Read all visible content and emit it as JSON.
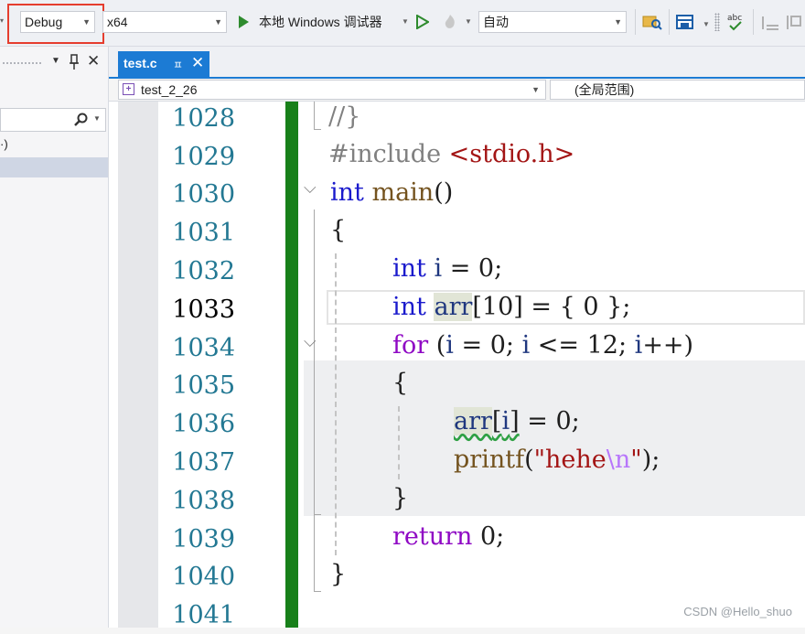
{
  "toolbar": {
    "config": "Debug",
    "platform": "x64",
    "run_target": "本地 Windows 调试器",
    "mode": "自动"
  },
  "left_panel": {
    "partial_item": "·)"
  },
  "tabs": [
    {
      "label": "test.c",
      "pin": "ㅍ",
      "close": "✕"
    }
  ],
  "navbar": {
    "project": "test_2_26",
    "scope": "(全局范围)"
  },
  "editor": {
    "lines": [
      {
        "no": "1028"
      },
      {
        "no": "1029"
      },
      {
        "no": "1030"
      },
      {
        "no": "1031"
      },
      {
        "no": "1032"
      },
      {
        "no": "1033"
      },
      {
        "no": "1034"
      },
      {
        "no": "1035"
      },
      {
        "no": "1036"
      },
      {
        "no": "1037"
      },
      {
        "no": "1038"
      },
      {
        "no": "1039"
      },
      {
        "no": "1040"
      },
      {
        "no": "1041"
      }
    ],
    "current_line": "1033"
  },
  "watermark": "CSDN @Hello_shuo",
  "colors": {
    "accent": "#1c7bd4",
    "change_bar": "#18801a",
    "highlight_box": "#e53d2e"
  }
}
